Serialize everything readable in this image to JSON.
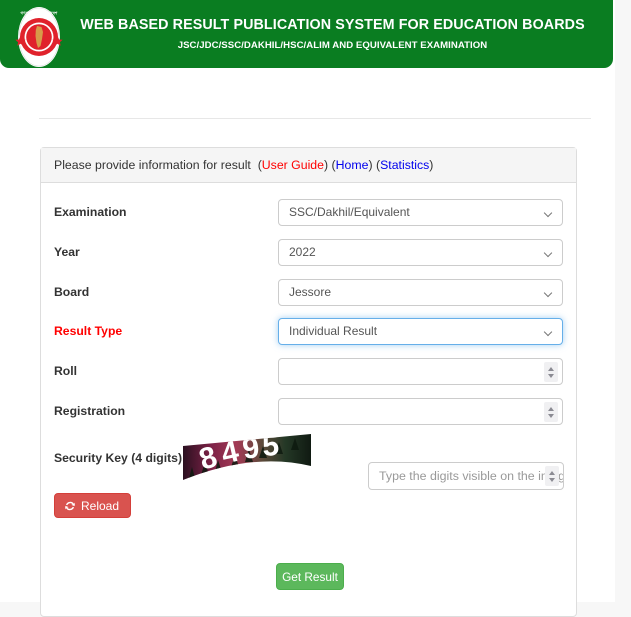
{
  "banner": {
    "title": "WEB BASED RESULT PUBLICATION SYSTEM FOR EDUCATION BOARDS",
    "subtitle": "JSC/JDC/SSC/DAKHIL/HSC/ALIM AND EQUIVALENT EXAMINATION",
    "emblem_icon": "bangladesh-government-emblem-icon",
    "bg_color": "#0a7d21"
  },
  "panel": {
    "heading": {
      "text": "Please provide information for result",
      "links": [
        {
          "label": "User Guide",
          "color": "#ff0000"
        },
        {
          "label": "Home",
          "color": "#0000ee"
        },
        {
          "label": "Statistics",
          "color": "#0000ee"
        }
      ]
    },
    "fields": [
      {
        "label": "Examination",
        "value": "SSC/Dakhil/Equivalent",
        "type": "select",
        "required": false,
        "focused": false
      },
      {
        "label": "Year",
        "value": "2022",
        "type": "select",
        "required": false,
        "focused": false
      },
      {
        "label": "Board",
        "value": "Jessore",
        "type": "select",
        "required": false,
        "focused": false
      },
      {
        "label": "Result Type",
        "value": "Individual Result",
        "type": "select",
        "required": true,
        "focused": true
      },
      {
        "label": "Roll",
        "value": "",
        "placeholder": "",
        "type": "number",
        "required": false,
        "focused": false
      },
      {
        "label": "Registration",
        "value": "",
        "placeholder": "",
        "type": "number",
        "required": false,
        "focused": false
      }
    ],
    "captcha": {
      "label": "Security Key (4 digits)",
      "image_digits": "8495",
      "image_icon": "captcha-image",
      "input_value": "",
      "input_placeholder": "Type the digits visible on the image",
      "reload_label": "Reload",
      "reload_icon": "refresh-icon",
      "reload_color": "#d9534f"
    },
    "submit": {
      "label": "Get Result",
      "color": "#5cb85c"
    }
  }
}
